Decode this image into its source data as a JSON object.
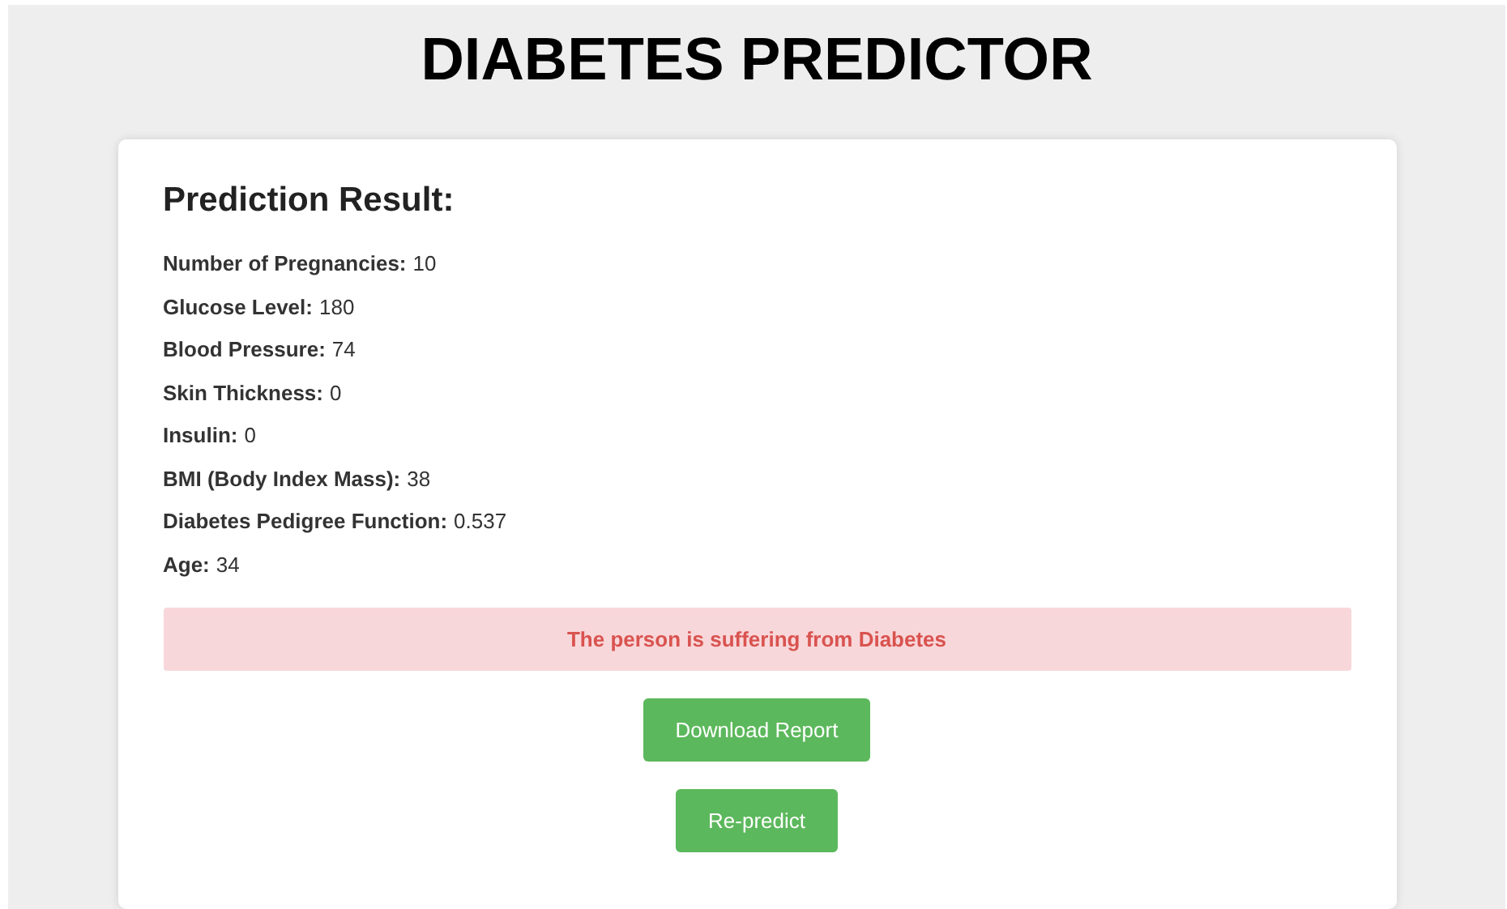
{
  "title": "DIABETES PREDICTOR",
  "card": {
    "heading": "Prediction Result:",
    "fields": [
      {
        "label": "Number of Pregnancies:",
        "value": "10"
      },
      {
        "label": "Glucose Level:",
        "value": "180"
      },
      {
        "label": "Blood Pressure:",
        "value": "74"
      },
      {
        "label": "Skin Thickness:",
        "value": "0"
      },
      {
        "label": "Insulin:",
        "value": "0"
      },
      {
        "label": "BMI (Body Index Mass):",
        "value": "38"
      },
      {
        "label": "Diabetes Pedigree Function:",
        "value": "0.537"
      },
      {
        "label": "Age:",
        "value": "34"
      }
    ],
    "result": {
      "kind": "danger",
      "text": "The person is suffering from Diabetes"
    },
    "buttons": [
      "Download Report",
      "Re-predict"
    ]
  }
}
